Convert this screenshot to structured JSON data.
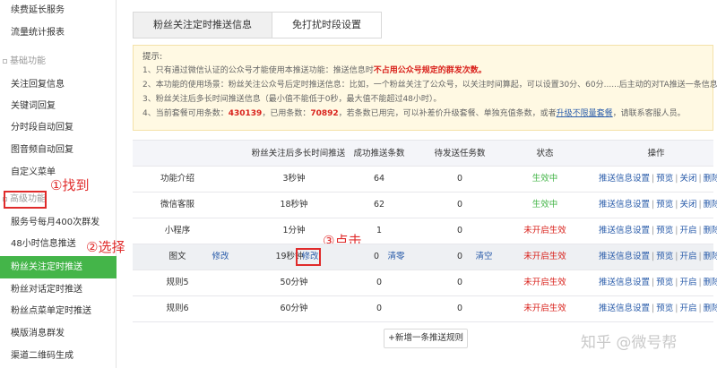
{
  "sidebar": {
    "items_top": [
      "续费延长服务",
      "流量统计报表"
    ],
    "group_basic": "基础功能",
    "items_basic": [
      "关注回复信息",
      "关键词回复",
      "分时段自动回复",
      "图音频自动回复",
      "自定义菜单"
    ],
    "group_advanced": "高级功能",
    "items_advanced": [
      "服务号每月400次群发",
      "48小时信息推送",
      "粉丝关注定时推送",
      "粉丝对话定时推送",
      "粉丝点菜单定时推送",
      "模版消息群发",
      "渠道二维码生成"
    ]
  },
  "annotations": {
    "find": "①找到",
    "select": "②选择",
    "click": "③点击"
  },
  "tabs": [
    "粉丝关注定时推送信息",
    "免打扰时段设置"
  ],
  "notice": {
    "title": "提示:",
    "line1a": "1、只有通过微信认证的公众号才能使用本推送功能：推送信息时",
    "line1b": "不占用公众号规定的群发次数。",
    "line2": "2、本功能的使用场景：粉丝关注公众号后定时推送信息：比如，一个粉丝关注了公众号，以关注时间算起，可以设置30分、60分......后主动的对TA推送一条信息。",
    "line3": "3、粉丝关注后多长时间推送信息（最小值不能低于0秒，最大值不能超过48小时）。",
    "line4a": "4、当前套餐可用条数：",
    "avail": "430139",
    "line4b": "，已用条数：",
    "used": "70892",
    "line4c": "，若条数已用完，可以补差价升级套餐、单独充值条数，或者",
    "line4link": "升级不限量套餐",
    "line4d": "，请联系客服人员。"
  },
  "table": {
    "headers": [
      "粉丝关注后多长时间推送",
      "成功推送条数",
      "待发送任务数",
      "状态",
      "操作"
    ],
    "rows": [
      {
        "name": "功能介绍",
        "time": "3秒钟",
        "success": "64",
        "pending": "0",
        "status": "生效中",
        "op1": "推送信息设置",
        "op2": "预览",
        "op3": "关闭",
        "op4": "删除"
      },
      {
        "name": "微信客服",
        "time": "18秒钟",
        "success": "62",
        "pending": "0",
        "status": "生效中",
        "op1": "推送信息设置",
        "op2": "预览",
        "op3": "关闭",
        "op4": "删除"
      },
      {
        "name": "小程序",
        "time": "1分钟",
        "success": "1",
        "pending": "0",
        "status": "未开启生效",
        "op1": "推送信息设置",
        "op2": "预览",
        "op3": "开启",
        "op4": "删除"
      },
      {
        "name": "图文",
        "edit": "修改",
        "time": "19秒钟",
        "edit2": "修改",
        "success": "0",
        "clear1": "清零",
        "pending": "0",
        "clear2": "清空",
        "status": "未开启生效",
        "op1": "推送信息设置",
        "op2": "预览",
        "op3": "开启",
        "op4": "删除"
      },
      {
        "name": "规则5",
        "time": "50分钟",
        "success": "0",
        "pending": "0",
        "status": "未开启生效",
        "op1": "推送信息设置",
        "op2": "预览",
        "op3": "开启",
        "op4": "删除"
      },
      {
        "name": "规则6",
        "time": "60分钟",
        "success": "0",
        "pending": "0",
        "status": "未开启生效",
        "op1": "推送信息设置",
        "op2": "预览",
        "op3": "开启",
        "op4": "删除"
      }
    ],
    "add_button": "+新增一条推送规则"
  },
  "watermark": "知乎 @微号帮",
  "colors": {
    "accent_green": "#44b549",
    "annotation_red": "#e02b2b",
    "link_blue": "#2a5caa"
  }
}
